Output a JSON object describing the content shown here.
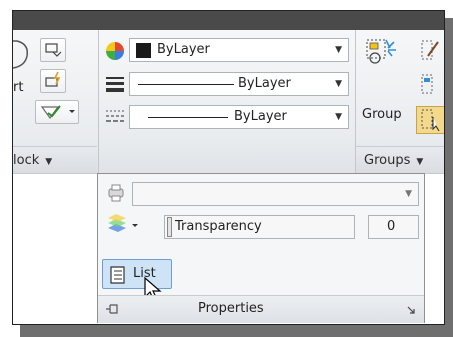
{
  "ribbon": {
    "block_panel": {
      "insert_label_partial": "rt",
      "title": "lock"
    },
    "properties_panel": {
      "color_value": "ByLayer",
      "linetype_value": "ByLayer",
      "lineweight_value": "ByLayer"
    },
    "groups_panel": {
      "group_label": "Group",
      "title": "Groups"
    }
  },
  "popup": {
    "plot_style_value": "",
    "transparency_label": "Transparency",
    "transparency_value": "0",
    "list_label": "List",
    "title": "Properties"
  },
  "colors": {
    "selected_highlight": "#cfe3f7",
    "selected_border": "#6f9fd0",
    "color_swatch": "#1a1a1a"
  }
}
